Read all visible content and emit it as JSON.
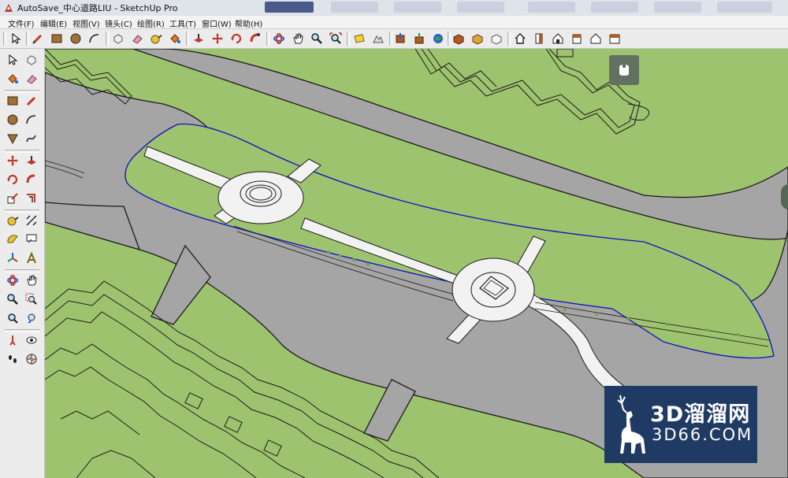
{
  "window": {
    "title": "AutoSave_中心道路LIU - SketchUp Pro"
  },
  "menu": [
    {
      "label": "文件(F)"
    },
    {
      "label": "编辑(E)"
    },
    {
      "label": "视图(V)"
    },
    {
      "label": "镜头(C)"
    },
    {
      "label": "绘图(R)"
    },
    {
      "label": "工具(T)"
    },
    {
      "label": "窗口(W)"
    },
    {
      "label": "帮助(H)"
    }
  ],
  "toolbar_icons": [
    "select-icon",
    "pencil-icon",
    "rectangle-icon",
    "circle-icon",
    "arc-icon",
    "make-component-icon",
    "eraser-icon",
    "tape-measure-icon",
    "paint-bucket-icon",
    "push-pull-icon",
    "move-icon",
    "rotate-icon",
    "follow-me-icon",
    "orbit-icon",
    "pan-icon",
    "zoom-icon",
    "zoom-extents-icon",
    "add-location-icon",
    "toggle-terrain-icon",
    "get-models-icon",
    "share-model-icon",
    "preview-google-earth-icon",
    "extension-warehouse-icon",
    "style-icon",
    "iso-view-icon",
    "top-view-icon",
    "front-view-icon",
    "right-view-icon",
    "back-view-icon",
    "left-view-icon"
  ],
  "left_icons": [
    "select-icon",
    "make-component-icon",
    "paint-bucket-icon",
    "eraser-icon",
    "rectangle-icon",
    "line-icon",
    "circle-icon",
    "arc-icon",
    "polygon-icon",
    "freehand-icon",
    "move-icon",
    "push-pull-icon",
    "rotate-icon",
    "follow-me-icon",
    "scale-icon",
    "offset-icon",
    "tape-measure-icon",
    "dimension-icon",
    "protractor-icon",
    "text-icon",
    "axes-icon",
    "3d-text-icon",
    "orbit-icon",
    "pan-icon",
    "zoom-icon",
    "zoom-window-icon",
    "zoom-extents-icon",
    "previous-icon",
    "position-camera-icon",
    "look-around-icon",
    "walk-icon",
    "section-plane-icon"
  ],
  "watermark": {
    "brand": "3D溜溜网",
    "domain": "3D66.COM"
  },
  "colors": {
    "grass": "#9ec36f",
    "road": "#a5a5a5",
    "path": "#f2f2f2",
    "selection": "#1010c0",
    "toolbar": "#ececec"
  }
}
